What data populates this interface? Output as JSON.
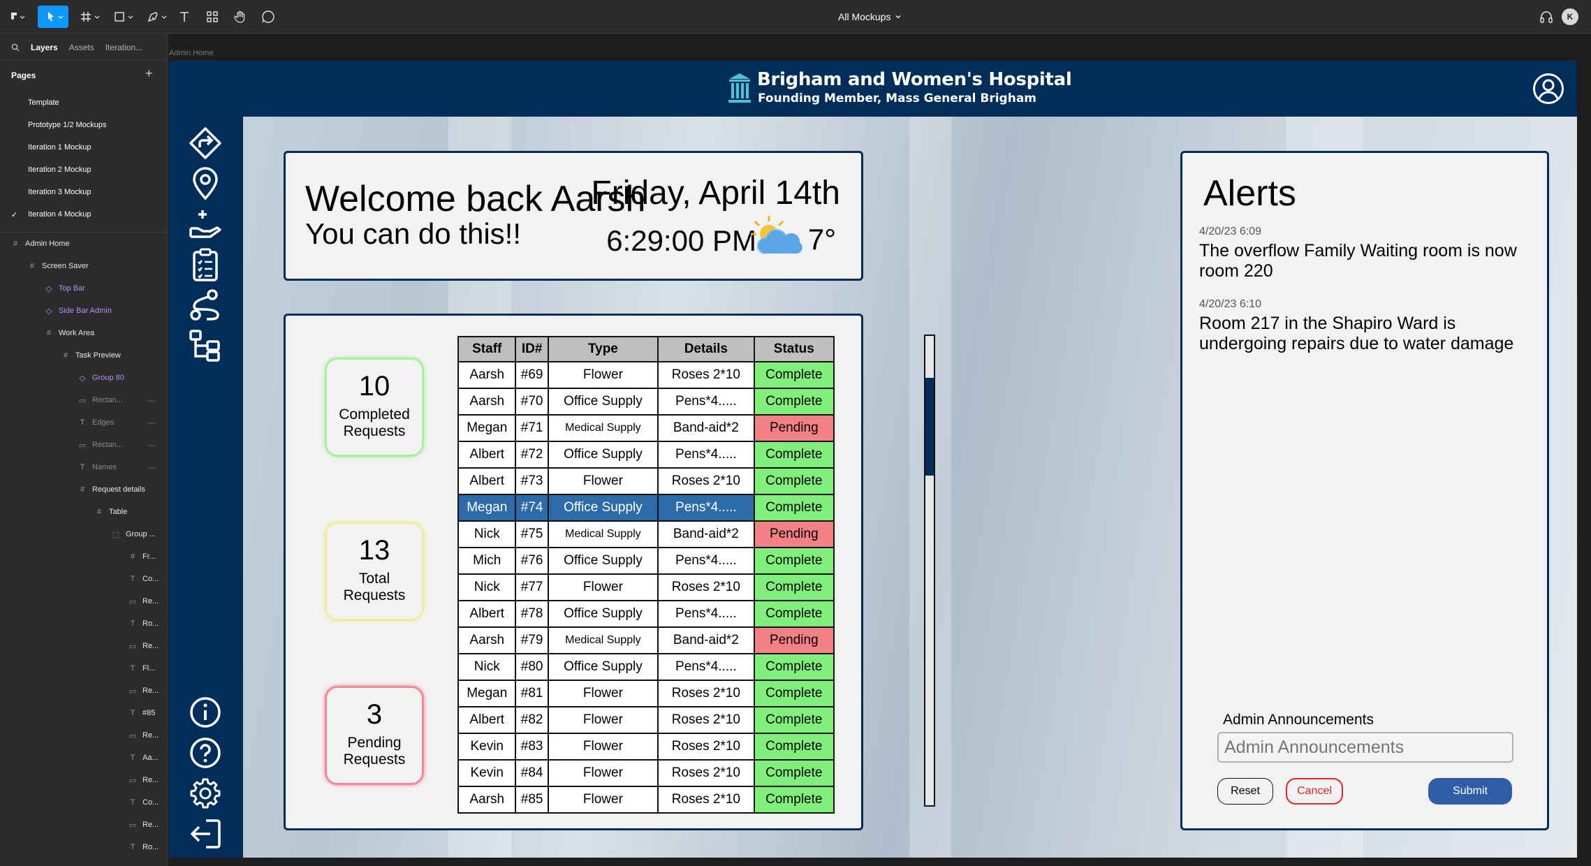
{
  "figma": {
    "file_title": "All Mockups",
    "avatar_initial": "K",
    "panel_tabs": [
      "Layers",
      "Assets",
      "Iteration..."
    ],
    "pages_header": "Pages",
    "pages": [
      "Template",
      "Prototype 1/2 Mockups",
      "Iteration 1 Mockup",
      "Iteration 2 Mockup",
      "Iteration 3 Mockup",
      "Iteration 4 Mockup"
    ],
    "current_page": "Iteration 4 Mockup",
    "layers": [
      {
        "name": "Admin Home",
        "icon": "frame-icon"
      },
      {
        "name": "Screen Saver",
        "icon": "frame-icon"
      },
      {
        "name": "Top Bar",
        "icon": "component-icon"
      },
      {
        "name": "Side Bar Admin",
        "icon": "component-icon"
      },
      {
        "name": "Work Area",
        "icon": "frame-icon"
      },
      {
        "name": "Task Preview",
        "icon": "frame-icon"
      },
      {
        "name": "Group 80",
        "icon": "component-icon"
      },
      {
        "name": "Rectan...",
        "icon": "rectangle-icon"
      },
      {
        "name": "Edges",
        "icon": "text-icon"
      },
      {
        "name": "Rectan...",
        "icon": "rectangle-icon"
      },
      {
        "name": "Names",
        "icon": "text-icon"
      },
      {
        "name": "Request details",
        "icon": "frame-icon"
      },
      {
        "name": "Table",
        "icon": "frame-icon"
      },
      {
        "name": "Group ...",
        "icon": "group-icon"
      },
      {
        "name": "Fr...",
        "icon": "frame-icon"
      },
      {
        "name": "Co...",
        "icon": "text-icon"
      },
      {
        "name": "Re...",
        "icon": "rectangle-icon"
      },
      {
        "name": "Ro...",
        "icon": "text-icon"
      },
      {
        "name": "Re...",
        "icon": "rectangle-icon"
      },
      {
        "name": "Fl...",
        "icon": "text-icon"
      },
      {
        "name": "Re...",
        "icon": "rectangle-icon"
      },
      {
        "name": "#85",
        "icon": "text-icon"
      },
      {
        "name": "Re...",
        "icon": "rectangle-icon"
      },
      {
        "name": "Aa...",
        "icon": "text-icon"
      },
      {
        "name": "Re...",
        "icon": "rectangle-icon"
      },
      {
        "name": "Co...",
        "icon": "text-icon"
      },
      {
        "name": "Re...",
        "icon": "rectangle-icon"
      },
      {
        "name": "Ro...",
        "icon": "text-icon"
      }
    ],
    "frame_label": "Admin Home"
  },
  "app": {
    "hospital_name": "Brigham and Women's Hospital",
    "hospital_sub": "Founding Member, Mass General Brigham",
    "brand_color": "#012d5a",
    "sidebar_icons": [
      "directions-icon",
      "location-pin-icon",
      "service-request-icon",
      "clipboard-list-icon",
      "path-nodes-icon",
      "org-chart-icon",
      "info-icon",
      "help-icon",
      "settings-gear-icon",
      "logout-icon"
    ],
    "welcome": {
      "greeting": "Welcome back Aarsh",
      "motivation": "You can do this!!",
      "date": "Friday, April 14th",
      "time": "6:29:00 PM",
      "temperature": "7°",
      "weather_icon": "partly-cloudy-icon"
    },
    "stats": [
      {
        "value": "10",
        "label": "Completed Requests",
        "color": "#a8ee9e"
      },
      {
        "value": "13",
        "label": "Total Requests",
        "color": "#f2ec9a"
      },
      {
        "value": "3",
        "label": "Pending Requests",
        "color": "#f28a95"
      }
    ],
    "table": {
      "columns": [
        "Staff",
        "ID#",
        "Type",
        "Details",
        "Status"
      ],
      "rows": [
        [
          "Aarsh",
          "#69",
          "Flower",
          "Roses 2*10",
          "Complete"
        ],
        [
          "Aarsh",
          "#70",
          "Office Supply",
          "Pens*4.....",
          "Complete"
        ],
        [
          "Megan",
          "#71",
          "Medical Supply",
          "Band-aid*2",
          "Pending"
        ],
        [
          "Albert",
          "#72",
          "Office Supply",
          "Pens*4.....",
          "Complete"
        ],
        [
          "Albert",
          "#73",
          "Flower",
          "Roses 2*10",
          "Complete"
        ],
        [
          "Megan",
          "#74",
          "Office Supply",
          "Pens*4.....",
          "Complete"
        ],
        [
          "Nick",
          "#75",
          "Medical Supply",
          "Band-aid*2",
          "Pending"
        ],
        [
          "Mich",
          "#76",
          "Office Supply",
          "Pens*4.....",
          "Complete"
        ],
        [
          "Nick",
          "#77",
          "Flower",
          "Roses 2*10",
          "Complete"
        ],
        [
          "Albert",
          "#78",
          "Office Supply",
          "Pens*4.....",
          "Complete"
        ],
        [
          "Aarsh",
          "#79",
          "Medical Supply",
          "Band-aid*2",
          "Pending"
        ],
        [
          "Nick",
          "#80",
          "Office Supply",
          "Pens*4.....",
          "Complete"
        ],
        [
          "Megan",
          "#81",
          "Flower",
          "Roses 2*10",
          "Complete"
        ],
        [
          "Albert",
          "#82",
          "Flower",
          "Roses 2*10",
          "Complete"
        ],
        [
          "Kevin",
          "#83",
          "Flower",
          "Roses 2*10",
          "Complete"
        ],
        [
          "Kevin",
          "#84",
          "Flower",
          "Roses 2*10",
          "Complete"
        ],
        [
          "Aarsh",
          "#85",
          "Flower",
          "Roses 2*10",
          "Complete"
        ]
      ],
      "selected_row": 5
    },
    "alerts": {
      "title": "Alerts",
      "items": [
        {
          "time": "4/20/23 6:09",
          "message": "The overflow Family Waiting room is now room 220"
        },
        {
          "time": "4/20/23 6:10",
          "message": "Room 217 in the Shapiro Ward is undergoing repairs due to water damage"
        }
      ],
      "announcement_label": "Admin Announcements",
      "announcement_placeholder": "Admin Announcements",
      "reset_label": "Reset",
      "cancel_label": "Cancel",
      "submit_label": "Submit"
    }
  }
}
